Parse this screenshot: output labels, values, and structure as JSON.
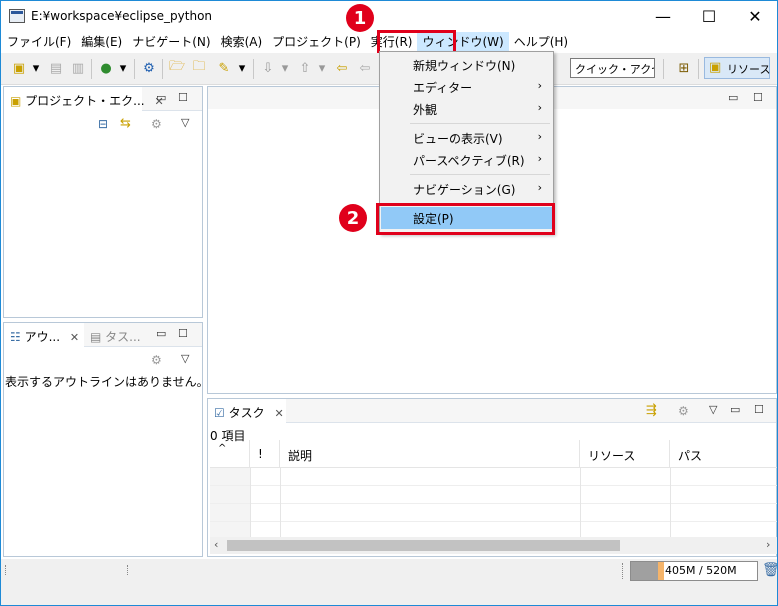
{
  "window": {
    "title": "E:¥workspace¥eclipse_python"
  },
  "titlebar": {
    "minimize": "—",
    "maximize": "☐",
    "close": "✕"
  },
  "menubar": {
    "items": [
      {
        "label": "ファイル(F)"
      },
      {
        "label": "編集(E)"
      },
      {
        "label": "ナビゲート(N)"
      },
      {
        "label": "検索(A)"
      },
      {
        "label": "プロジェクト(P)"
      },
      {
        "label": "実行(R)"
      },
      {
        "label": "ウィンドウ(W)"
      },
      {
        "label": "ヘルプ(H)"
      }
    ]
  },
  "toolbar": {
    "quick_access": "クイック・アクセス",
    "perspective": "リソース"
  },
  "window_menu": {
    "items": [
      {
        "label": "新規ウィンドウ(N)",
        "submenu": false
      },
      {
        "label": "エディター",
        "submenu": true
      },
      {
        "label": "外観",
        "submenu": true
      },
      {
        "label": "ビューの表示(V)",
        "submenu": true
      },
      {
        "label": "パースペクティブ(R)",
        "submenu": true
      },
      {
        "label": "ナビゲーション(G)",
        "submenu": true
      },
      {
        "label": "設定(P)",
        "submenu": false
      }
    ],
    "arrow": "›"
  },
  "annotations": {
    "step1": "1",
    "step2": "2"
  },
  "explorer": {
    "tab_label": "プロジェクト・エク..."
  },
  "outline": {
    "tab_label": "アウ...",
    "tab2_label": "タス...",
    "message": "表示するアウトラインはありません。"
  },
  "tasks": {
    "tab_label": "タスク",
    "count": "0 項目",
    "columns": [
      "!",
      "説明",
      "リソース",
      "パス"
    ]
  },
  "status": {
    "heap": "405M / 520M"
  }
}
